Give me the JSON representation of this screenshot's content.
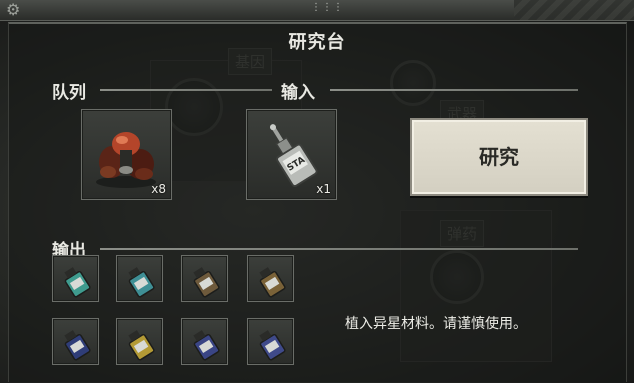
{
  "window": {
    "title": "研究台"
  },
  "background": {
    "signs": [
      "基因",
      "武器",
      "弹药"
    ]
  },
  "queue": {
    "label": "队列",
    "item": {
      "name": "alien-organ-icon",
      "count": "x8"
    }
  },
  "input": {
    "label": "输入",
    "item": {
      "name": "sta-vial-icon",
      "count": "x1"
    }
  },
  "research_button": {
    "label": "研究"
  },
  "output": {
    "label": "输出",
    "slots": [
      {
        "icon": "vial-teal-icon",
        "color": "#3f9b8e"
      },
      {
        "icon": "vial-teal-icon",
        "color": "#3f8f95"
      },
      {
        "icon": "vial-brown-icon",
        "color": "#6e5a3c"
      },
      {
        "icon": "vial-brown-icon",
        "color": "#7a6238"
      },
      {
        "icon": "vial-navy-icon",
        "color": "#2f3d78"
      },
      {
        "icon": "vial-yellow-icon",
        "color": "#b39a35"
      },
      {
        "icon": "vial-navy-icon",
        "color": "#3a4585"
      },
      {
        "icon": "vial-navy-icon",
        "color": "#3f4a8a"
      }
    ]
  },
  "warning_text": "植入异星材料。请谨慎使用。",
  "colors": {
    "button_bg": "#ddd9cb",
    "text": "#e9e9e3"
  }
}
